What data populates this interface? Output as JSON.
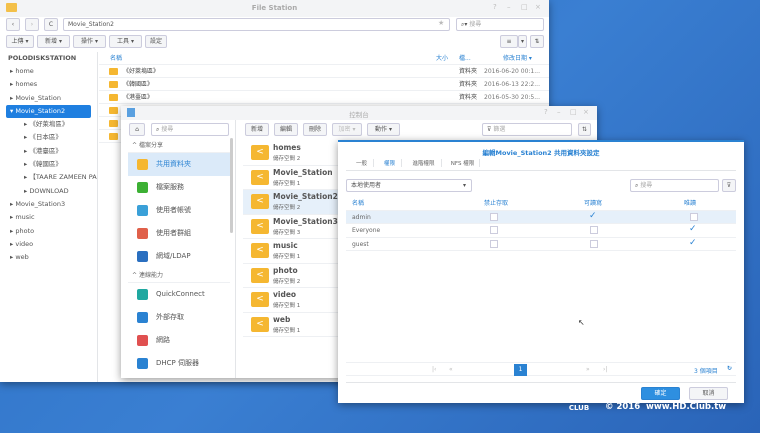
{
  "file_station": {
    "title": "File Station",
    "path": "Movie_Station2",
    "search_placeholder": "搜尋",
    "toolbar": [
      "上傳 ▾",
      "新增 ▾",
      "操作 ▾",
      "工具 ▾",
      "設定"
    ],
    "tree_root": "POLODISKSTATION",
    "tree": [
      {
        "label": "home",
        "level": 1
      },
      {
        "label": "homes",
        "level": 1
      },
      {
        "label": "Movie_Station",
        "level": 1
      },
      {
        "label": "Movie_Station2",
        "level": 1,
        "selected": true
      },
      {
        "label": "《好萊塢區》",
        "level": 2
      },
      {
        "label": "《日本區》",
        "level": 2
      },
      {
        "label": "《港臺區》",
        "level": 2
      },
      {
        "label": "《韓國區》",
        "level": 2
      },
      {
        "label": "【TAARE ZAMEEN PA",
        "level": 2
      },
      {
        "label": "DOWNLOAD",
        "level": 2
      },
      {
        "label": "Movie_Station3",
        "level": 1
      },
      {
        "label": "music",
        "level": 1
      },
      {
        "label": "photo",
        "level": 1
      },
      {
        "label": "video",
        "level": 1
      },
      {
        "label": "web",
        "level": 1
      }
    ],
    "columns": {
      "name": "名稱",
      "size": "大小",
      "type": "檔...",
      "modified": "修改日期 ▾"
    },
    "files": [
      {
        "name": "《好萊塢區》",
        "type": "資料夾",
        "modified": "2016-06-20 00:1..."
      },
      {
        "name": "《韓國區》",
        "type": "資料夾",
        "modified": "2016-06-13 22:2..."
      },
      {
        "name": "《港臺區》",
        "type": "資料夾",
        "modified": "2016-05-30 20:5..."
      }
    ]
  },
  "control_panel": {
    "title": "控制台",
    "search_placeholder": "搜尋",
    "toolbar": [
      "新增",
      "編輯",
      "刪除",
      "加密 ▾",
      "動作 ▾"
    ],
    "filter_placeholder": "篩選",
    "sections": [
      {
        "label": "檔案分享",
        "items": [
          {
            "label": "共用資料夾",
            "selected": true,
            "color": "#f5b731"
          },
          {
            "label": "檔案服務",
            "color": "#3cb034"
          },
          {
            "label": "使用者帳號",
            "color": "#3aa0d8"
          },
          {
            "label": "使用者群組",
            "color": "#e0604a"
          },
          {
            "label": "網域/LDAP",
            "color": "#2a6fc0"
          }
        ]
      },
      {
        "label": "連線能力",
        "items": [
          {
            "label": "QuickConnect",
            "color": "#1fa8a0"
          },
          {
            "label": "外部存取",
            "color": "#2a82d2"
          },
          {
            "label": "網路",
            "color": "#e05050"
          },
          {
            "label": "DHCP 伺服器",
            "color": "#2a82d2"
          }
        ]
      }
    ],
    "shares": [
      {
        "name": "homes",
        "volume": "儲存空間 2"
      },
      {
        "name": "Movie_Station",
        "volume": "儲存空間 1"
      },
      {
        "name": "Movie_Station2",
        "volume": "儲存空間 2",
        "selected": true
      },
      {
        "name": "Movie_Station3",
        "volume": "儲存空間 3"
      },
      {
        "name": "music",
        "volume": "儲存空間 1"
      },
      {
        "name": "photo",
        "volume": "儲存空間 2"
      },
      {
        "name": "video",
        "volume": "儲存空間 1"
      },
      {
        "name": "web",
        "volume": "儲存空間 1"
      }
    ]
  },
  "dialog": {
    "title": "編輯Movie_Station2 共用資料夾設定",
    "tabs": [
      "一般",
      "權限",
      "進階權限",
      "NFS 權限"
    ],
    "active_tab": 1,
    "user_type": "本地使用者",
    "search_placeholder": "搜尋",
    "columns": [
      "名稱",
      "禁止存取",
      "可讀寫",
      "唯讀"
    ],
    "rows": [
      {
        "name": "admin",
        "deny": false,
        "rw": true,
        "ro": false
      },
      {
        "name": "Everyone",
        "deny": false,
        "rw": false,
        "ro": true
      },
      {
        "name": "guest",
        "deny": false,
        "rw": false,
        "ro": true
      }
    ],
    "page": "1",
    "item_count": "3 個項目",
    "ok": "確定",
    "cancel": "取消"
  },
  "watermark": {
    "logo": "HD CLUB",
    "text": "© 2016  www.HD.Club.tw"
  }
}
